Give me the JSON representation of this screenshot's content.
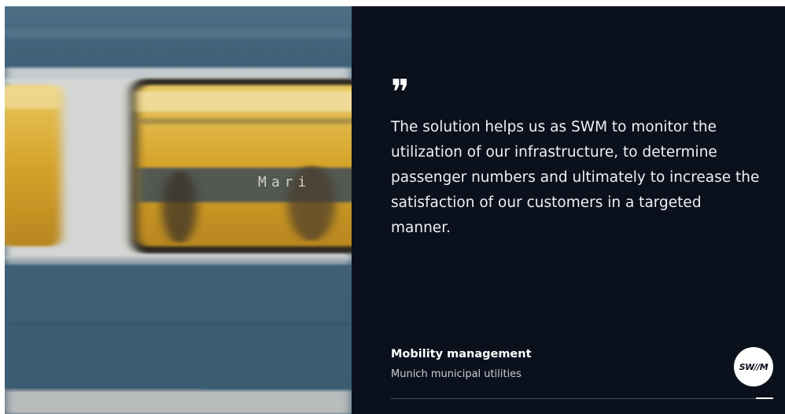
{
  "photo": {
    "alt_scene": "train",
    "station_sign_text": "Mari"
  },
  "quote": {
    "mark": "\"",
    "text": "The solution helps us as SWM to monitor the utilization of our infrastructure, to determine passenger numbers and ultimately to increase the satisfaction of our customers in a targeted manner."
  },
  "author": {
    "name": "Mobility management",
    "organization": "Munich municipal utilities"
  },
  "logo": {
    "text": "SW//M"
  },
  "slider": {
    "active_index": 5,
    "total": 5,
    "progress_fraction": 1.0
  },
  "colors": {
    "panel_background": "#0b111c",
    "train_body": "#3f6278",
    "window_yellow": "#d8a92e",
    "text": "#eef1f5"
  }
}
